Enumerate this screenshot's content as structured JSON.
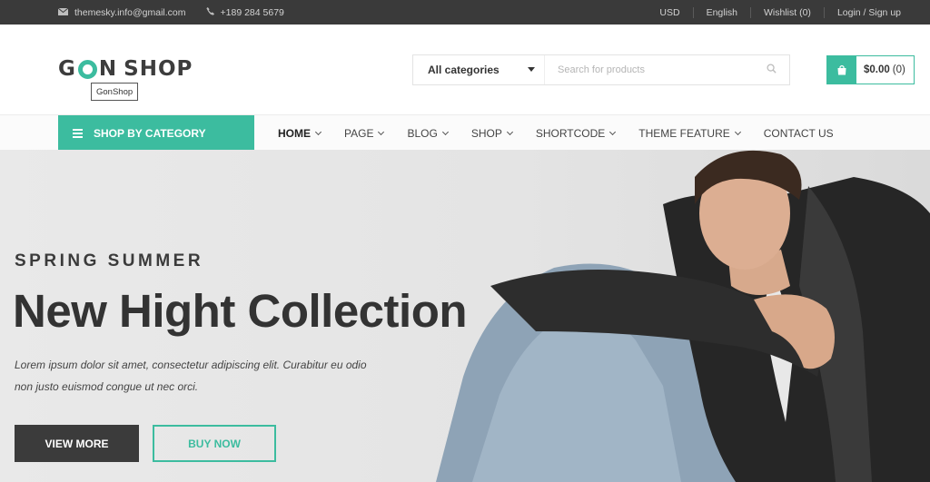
{
  "topbar": {
    "email": "themesky.info@gmail.com",
    "phone": "+189 284 5679",
    "currency": "USD",
    "language": "English",
    "wishlist": "Wishlist (0)",
    "account": "Login / Sign up"
  },
  "header": {
    "logo_prefix": "G",
    "logo_suffix": "N",
    "logo_word": "SHOP",
    "logo_tooltip": "GonShop",
    "category_select": "All categories",
    "search_placeholder": "Search for products",
    "cart_total": "$0.00",
    "cart_count": "(0)"
  },
  "nav": {
    "shop_by_category": "SHOP BY CATEGORY",
    "items": [
      {
        "label": "HOME"
      },
      {
        "label": "PAGE"
      },
      {
        "label": "BLOG"
      },
      {
        "label": "SHOP"
      },
      {
        "label": "SHORTCODE"
      },
      {
        "label": "THEME FEATURE"
      },
      {
        "label": "CONTACT US"
      }
    ]
  },
  "hero": {
    "eyebrow": "SPRING SUMMER",
    "title": "New Hight Collection",
    "description": "Lorem ipsum dolor sit amet, consectetur adipiscing elit. Curabitur eu odio non justo euismod congue ut nec orci.",
    "btn_primary": "VIEW MORE",
    "btn_secondary": "BUY NOW"
  },
  "colors": {
    "accent": "#3cbc9f",
    "topbar": "#3a3a3a",
    "dark_button": "#3b3b3b"
  },
  "icons": [
    "envelope-icon",
    "phone-icon",
    "search-icon",
    "shopping-bag-icon",
    "menu-bars-icon",
    "chevron-down-icon"
  ]
}
